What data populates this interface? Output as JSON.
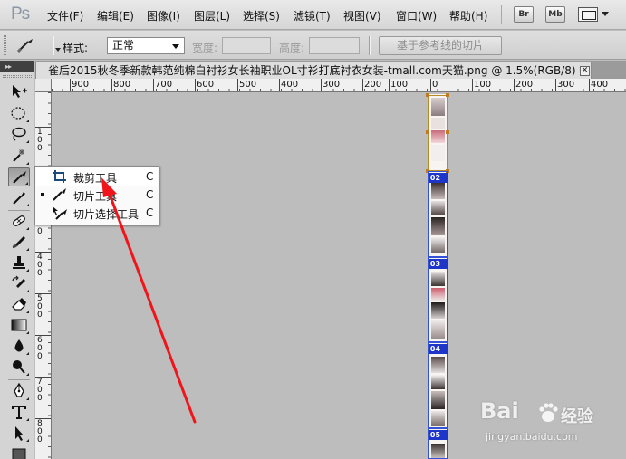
{
  "app": {
    "logo": "Ps",
    "menu": [
      "文件(F)",
      "编辑(E)",
      "图像(I)",
      "图层(L)",
      "选择(S)",
      "滤镜(T)",
      "视图(V)",
      "窗口(W)",
      "帮助(H)"
    ],
    "bridge_label": "Br",
    "minibridge_label": "Mb"
  },
  "options": {
    "style_label": "样式:",
    "style_value": "正常",
    "width_label": "宽度:",
    "height_label": "高度:",
    "guides_button": "基于参考线的切片"
  },
  "toolbar": {
    "collapse_label": "▸▸"
  },
  "document": {
    "tab_title": "雀后2015秋冬季新款韩范纯棉白衬衫女长袖职业OL寸衫打底衬衣女装-tmall.com天猫.png @ 1.5%(RGB/8) *",
    "close_glyph": "✕"
  },
  "rulers": {
    "top_labels": [
      "900",
      "800",
      "700",
      "600",
      "500",
      "400",
      "300",
      "200",
      "100",
      "0",
      "100",
      "200",
      "300",
      "400"
    ],
    "left_labels": [
      "1",
      "0",
      "0",
      "2",
      "0",
      "0",
      "3",
      "0",
      "0",
      "4",
      "0",
      "0",
      "5",
      "0",
      "0",
      "6",
      "0",
      "0",
      "7",
      "0",
      "0",
      "8",
      "0",
      "0",
      "9",
      "0",
      "0"
    ]
  },
  "flyout": {
    "items": [
      {
        "label": "裁剪工具",
        "shortcut": "C",
        "selected": false,
        "highlighted": true
      },
      {
        "label": "切片工具",
        "shortcut": "C",
        "selected": true,
        "highlighted": false
      },
      {
        "label": "切片选择工具",
        "shortcut": "C",
        "selected": false,
        "highlighted": false
      }
    ]
  },
  "slices": [
    "02",
    "03",
    "04",
    "05"
  ],
  "watermark": {
    "brand": "Bai",
    "brand_cn": "经验",
    "url": "jingyan.baidu.com"
  },
  "colors": {
    "arrow": "#f0151a",
    "slice_label": "#1d35c9",
    "slice_active": "#b58b2a"
  }
}
